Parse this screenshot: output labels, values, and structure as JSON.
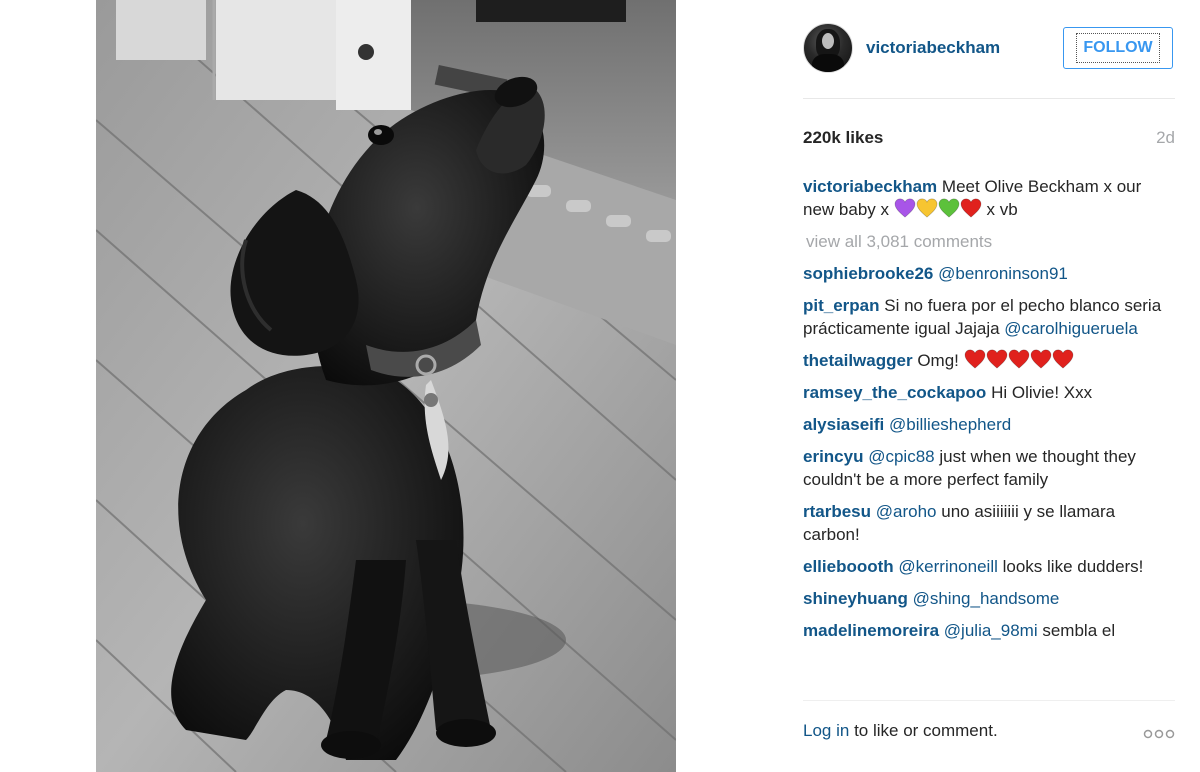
{
  "post": {
    "author": "victoriabeckham",
    "follow_label": "FOLLOW",
    "likes": "220k likes",
    "age": "2d",
    "caption_text": "Meet Olive Beckham x our new baby x",
    "caption_suffix": "x vb",
    "caption_emoji": [
      "purple-heart",
      "yellow-heart",
      "green-heart",
      "red-heart"
    ],
    "view_all": "view all 3,081 comments"
  },
  "comments": [
    {
      "user": "sophiebrooke26",
      "mention": "@benroninson91",
      "text": ""
    },
    {
      "user": "pit_erpan",
      "mention": "",
      "text": "Si no fuera por el pecho blanco seria prácticamente igual Jajaja",
      "mention_after": "@carolhigueruela"
    },
    {
      "user": "thetailwagger",
      "mention": "",
      "text": "Omg!",
      "emoji": [
        "red-heart",
        "red-heart",
        "red-heart",
        "red-heart",
        "red-heart"
      ]
    },
    {
      "user": "ramsey_the_cockapoo",
      "mention": "",
      "text": "Hi Olivie! Xxx"
    },
    {
      "user": "alysiaseifi",
      "mention": "@billieshepherd",
      "text": ""
    },
    {
      "user": "erincyu",
      "mention": "@cpic88",
      "text": "just when we thought they couldn't be a more perfect family"
    },
    {
      "user": "rtarbesu",
      "mention": "@aroho",
      "text": "uno asiiiiiii y se llamara carbon!"
    },
    {
      "user": "ellieboooth",
      "mention": "@kerrinoneill",
      "text": "looks like dudders!"
    },
    {
      "user": "shineyhuang",
      "mention": "@shing_handsome",
      "text": ""
    },
    {
      "user": "madelinemoreira",
      "mention": "@julia_98mi",
      "text": "sembla el"
    }
  ],
  "footer": {
    "login_link": "Log in",
    "login_text": "to like or comment."
  },
  "colors": {
    "link": "#125688",
    "follow_blue": "#3897f0",
    "muted": "#a5a7aa",
    "heart_red": "#e0211d",
    "heart_purple": "#a855e8",
    "heart_yellow": "#f7c531",
    "heart_green": "#5cc13b"
  },
  "icons": {
    "more": "ellipsis-icon",
    "heart": "heart-icon"
  }
}
